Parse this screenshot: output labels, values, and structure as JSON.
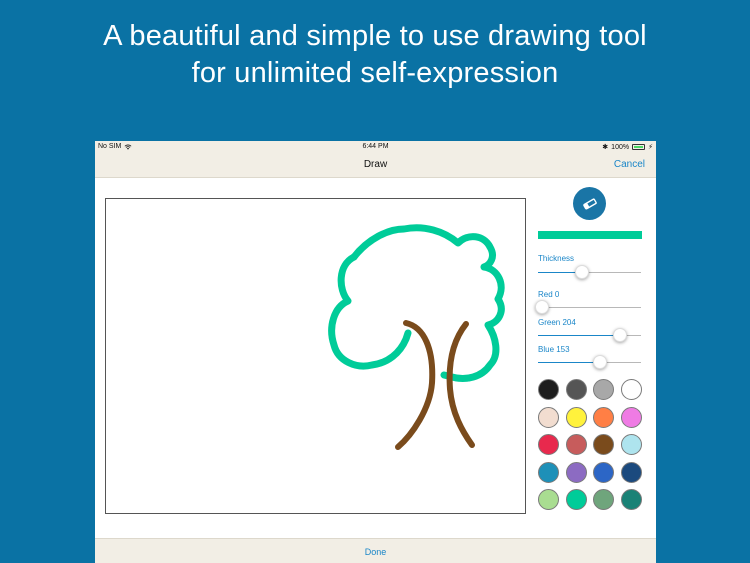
{
  "headline": {
    "line1": "A beautiful and simple to use drawing tool",
    "line2": "for unlimited self-expression"
  },
  "statusbar": {
    "carrier": "No SIM",
    "time": "6:44 PM",
    "battery": "100%"
  },
  "navbar": {
    "title": "Draw",
    "cancel_label": "Cancel"
  },
  "tools": {
    "eraser_icon": "eraser-icon",
    "current_color": "#00cc99"
  },
  "sliders": [
    {
      "label": "Thickness",
      "value": 0.43
    },
    {
      "label": "Red 0",
      "value": 0.0
    },
    {
      "label": "Green 204",
      "value": 0.8
    },
    {
      "label": "Blue 153",
      "value": 0.6
    }
  ],
  "palette": [
    "#1d1d1d",
    "#555555",
    "#a8a8a8",
    "#ffffff",
    "#f2ddd0",
    "#fff23c",
    "#ff7f45",
    "#ef7be4",
    "#e8294d",
    "#c75c5c",
    "#7a4b1c",
    "#aee4ee",
    "#1e90b8",
    "#8c6bc2",
    "#2c66c6",
    "#1b4a7e",
    "#a9dd91",
    "#00cc99",
    "#6fa57c",
    "#1a8276"
  ],
  "drawing_colors": {
    "foliage": "#00cc99",
    "trunk": "#7a4b1c"
  },
  "bottombar": {
    "done_label": "Done"
  }
}
